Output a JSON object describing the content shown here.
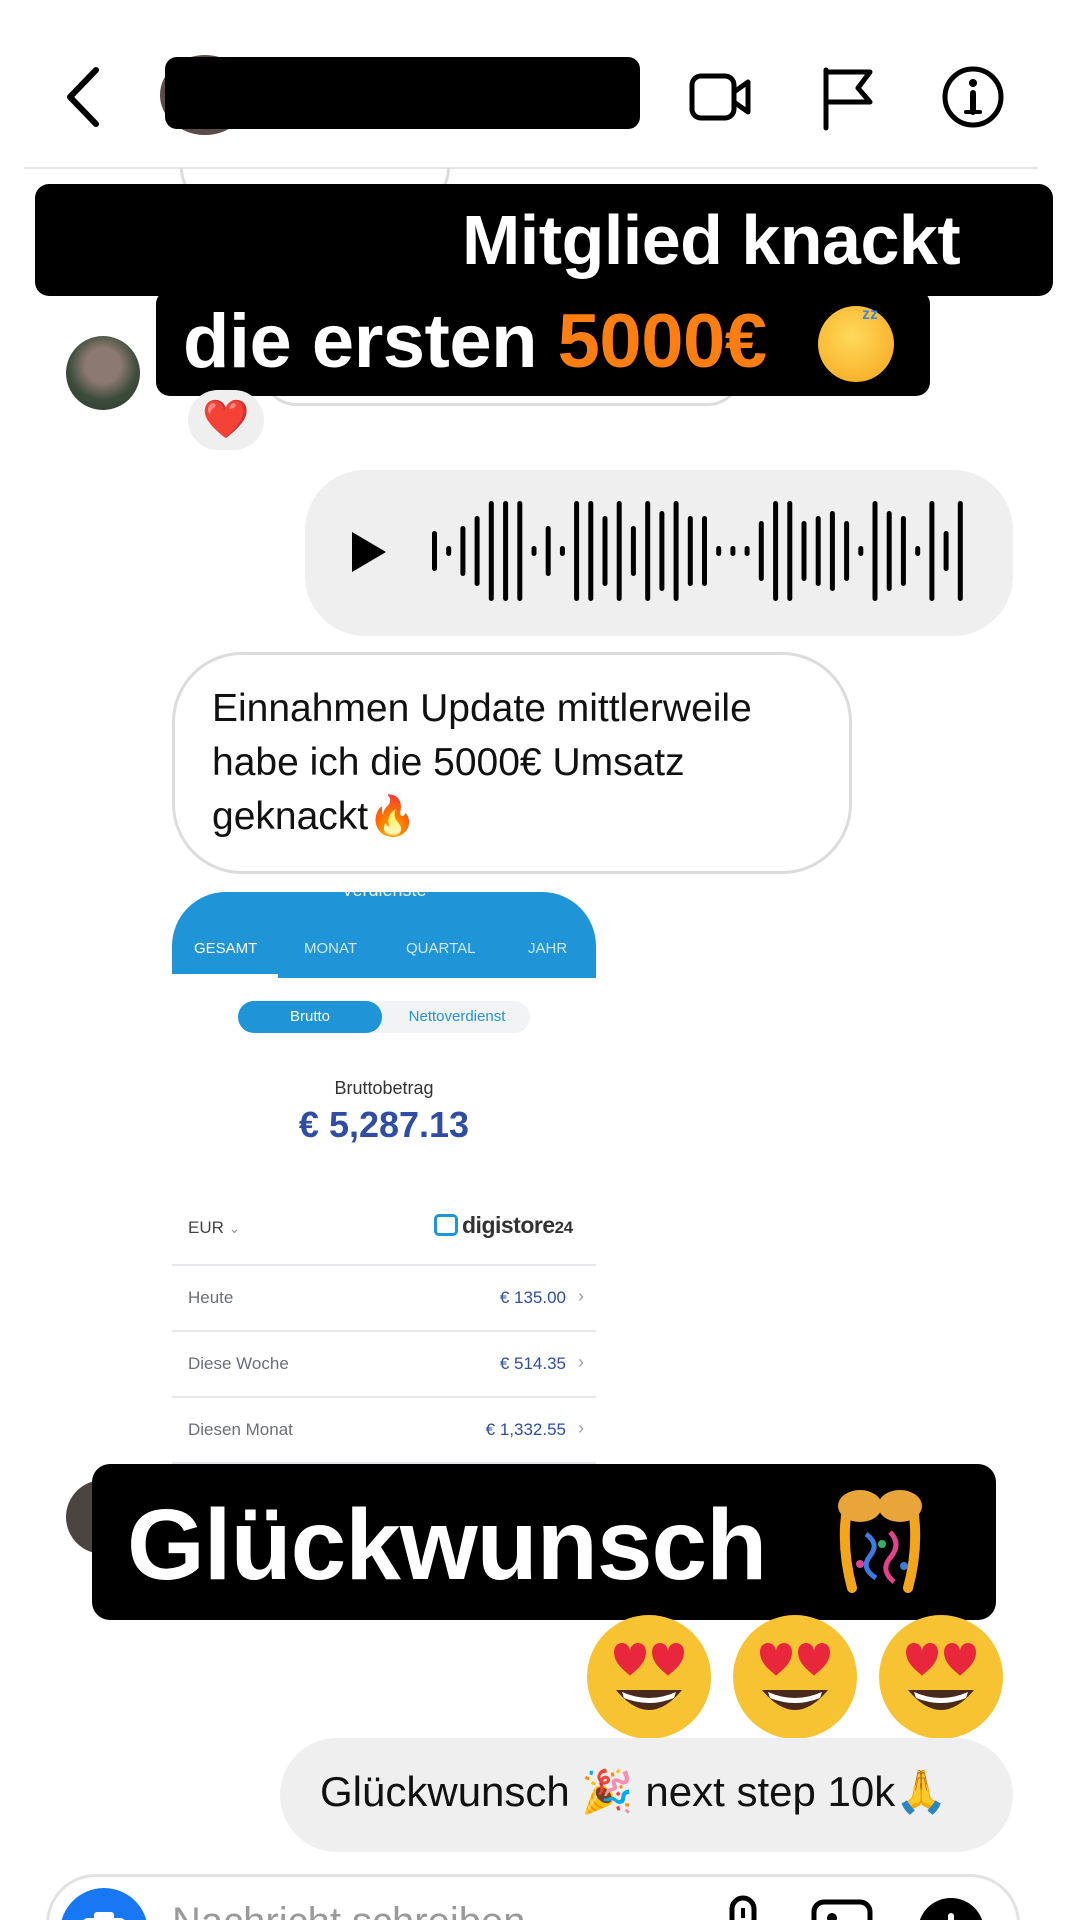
{
  "header": {
    "back_icon": "chevron-left-icon",
    "video_icon": "video-camera-icon",
    "flag_icon": "flag-icon",
    "info_icon": "info-icon"
  },
  "overlay_top": {
    "line1": "Mitglied knackt",
    "line2_prefix": "die ersten ",
    "line2_amount": "5000€",
    "emoji": "sleeping-face-emoji",
    "accent_color": "#ff7e11"
  },
  "reaction": {
    "emoji": "❤️"
  },
  "voice_message": {
    "play_icon": "play-icon"
  },
  "text_message": {
    "text": "Einnahmen Update mittlerweile habe ich die 5000€ Umsatz geknackt🔥"
  },
  "screenshot": {
    "header_title": "Verdienste",
    "tabs": [
      "GESAMT",
      "MONAT",
      "QUARTAL",
      "JAHR"
    ],
    "toggle_on": "Brutto",
    "toggle_off": "Nettoverdienst",
    "brutto_label": "Bruttobetrag",
    "brutto_value": "€ 5,287.13",
    "currency": "EUR",
    "brand": "digistore",
    "brand_suffix": "24",
    "rows": [
      {
        "label": "Heute",
        "value": "€ 135.00"
      },
      {
        "label": "Diese Woche",
        "value": "€ 514.35"
      },
      {
        "label": "Diesen Monat",
        "value": "€ 1,332.55"
      }
    ]
  },
  "overlay_bottom": {
    "text": "Glückwunsch",
    "emoji": "party-popper-icon"
  },
  "emoji_reply": [
    "heart-eyes-emoji",
    "heart-eyes-emoji",
    "heart-eyes-emoji"
  ],
  "last_message": {
    "text": "Glückwunsch 🎉 next step 10k🙏"
  },
  "composer": {
    "placeholder": "Nachricht schreiben…",
    "camera_icon": "camera-icon",
    "mic_icon": "microphone-icon",
    "gallery_icon": "gallery-icon",
    "plus_icon": "plus-icon"
  }
}
